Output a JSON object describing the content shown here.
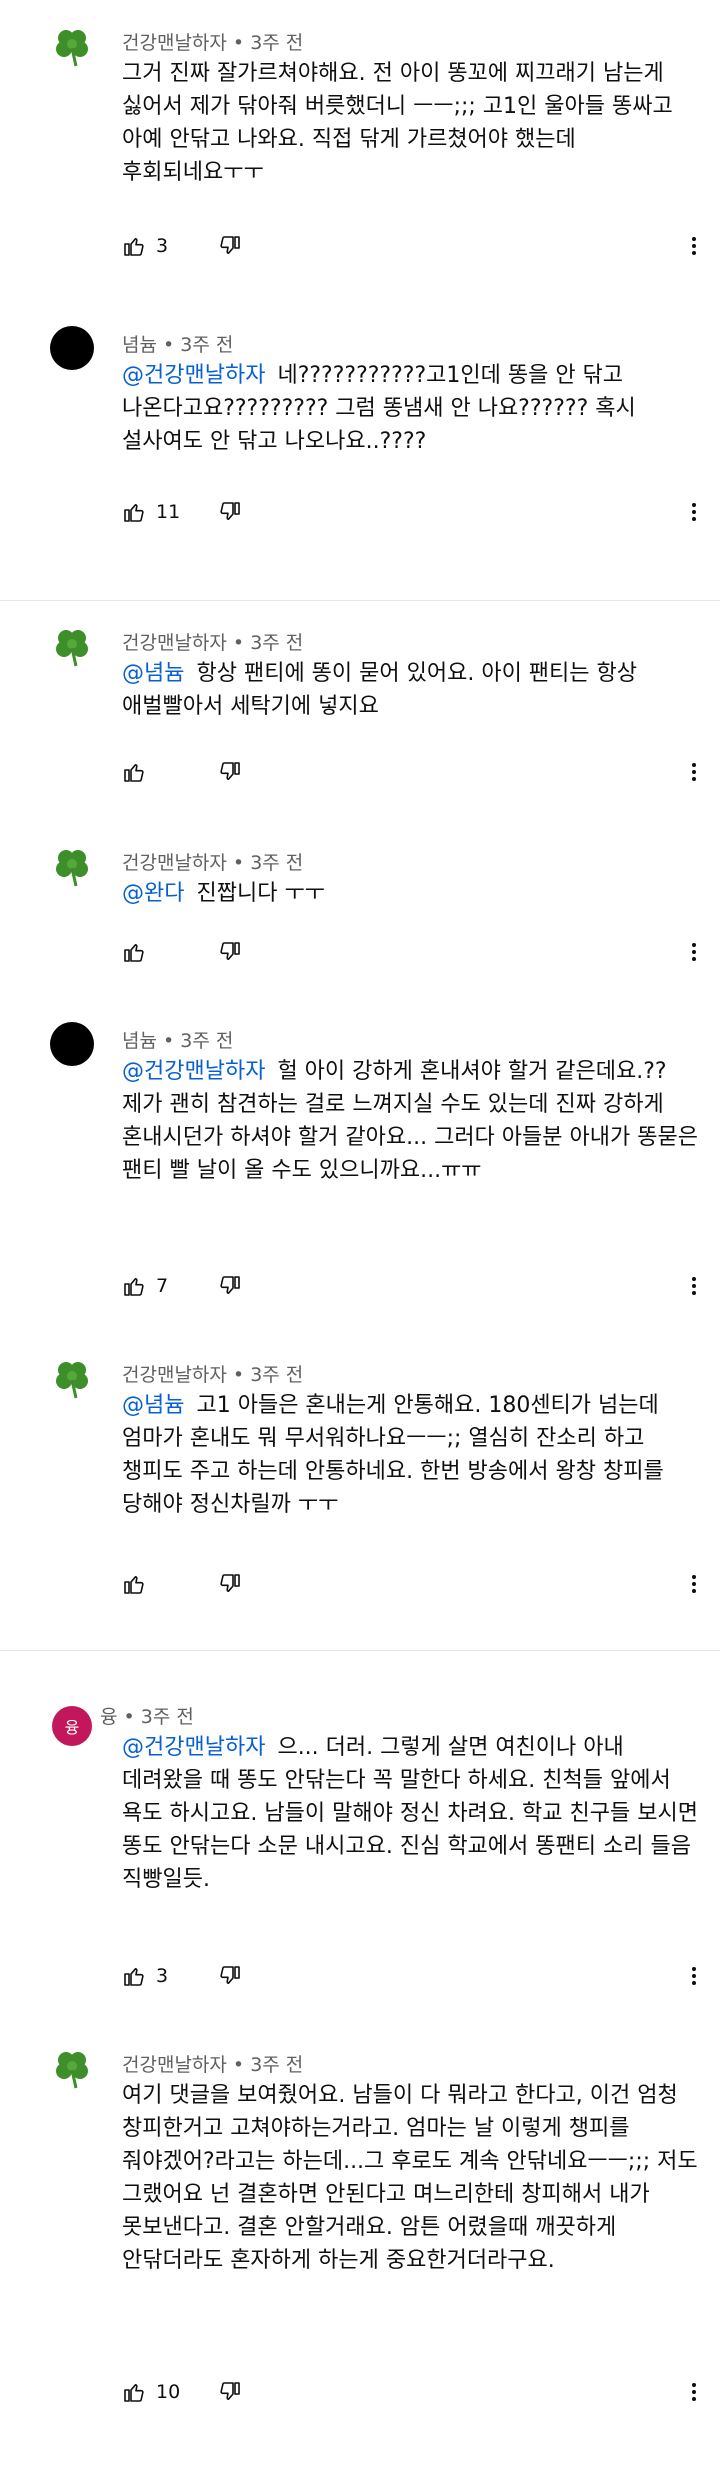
{
  "comments": [
    {
      "author": "건강맨날하자",
      "time": "3주 전",
      "avatar": "clover",
      "mention": "",
      "text": "그거 진짜 잘가르쳐야해요. 전 아이 똥꼬에 찌끄래기 남는게 싫어서 제가 닦아줘 버릇했더니 ㅡㅡ;;; 고1인 울아들 똥싸고 아예 안닦고 나와요. 직접 닦게 가르쳤어야 했는데 후회되네요ㅜㅜ",
      "likes": "3"
    },
    {
      "author": "념늄",
      "time": "3주 전",
      "avatar": "black",
      "mention": "@건강맨날하자",
      "text": "네???????????고1인데 똥을 안 닦고 나온다고요????????? 그럼 똥냄새 안 나요?????? 혹시 설사여도 안 닦고 나오나요..????",
      "likes": "11"
    },
    {
      "author": "건강맨날하자",
      "time": "3주 전",
      "avatar": "clover",
      "mention": "@념늄",
      "text": "항상 팬티에 똥이 묻어 있어요. 아이 팬티는 항상 애벌빨아서 세탁기에 넣지요",
      "likes": ""
    },
    {
      "author": "건강맨날하자",
      "time": "3주 전",
      "avatar": "clover",
      "mention": "@완다",
      "text": "진짭니다 ㅜㅜ",
      "likes": ""
    },
    {
      "author": "념늄",
      "time": "3주 전",
      "avatar": "black",
      "mention": "@건강맨날하자",
      "text": "헐 아이 강하게 혼내셔야 할거 같은데요.?? 제가 괜히 참견하는 걸로 느껴지실 수도 있는데 진짜 강하게 혼내시던가 하셔야 할거 같아요... 그러다 아들분 아내가 똥묻은 팬티 빨 날이 올 수도 있으니까요...ㅠㅠ",
      "likes": "7"
    },
    {
      "author": "건강맨날하자",
      "time": "3주 전",
      "avatar": "clover",
      "mention": "@념늄",
      "text": "고1 아들은 혼내는게 안통해요. 180센티가 넘는데 엄마가 혼내도 뭐 무서워하나요ㅡㅡ;; 열심히 잔소리 하고 챙피도 주고 하는데 안통하네요. 한번 방송에서 왕창 창피를 당해야 정신차릴까 ㅜㅜ",
      "likes": ""
    },
    {
      "author": "융",
      "time": "3주 전",
      "avatar": "letter",
      "avatar_letter": "융",
      "mention": "@건강맨날하자",
      "text": "으... 더러. 그렇게 살면 여친이나 아내 데려왔을 때 똥도 안닦는다 꼭 말한다 하세요. 친척들 앞에서 욕도 하시고요. 남들이 말해야 정신 차려요. 학교 친구들 보시면 똥도 안닦는다 소문 내시고요. 진심 학교에서 똥팬티 소리 들음 직빵일듯.",
      "likes": "3"
    },
    {
      "author": "건강맨날하자",
      "time": "3주 전",
      "avatar": "clover",
      "mention": "",
      "text": "여기 댓글을 보여줬어요. 남들이 다 뭐라고 한다고, 이건 엄청 창피한거고 고쳐야하는거라고. 엄마는 날 이렇게 챙피를 줘야겠어?라고는 하는데...그 후로도 계속 안닦네요ㅡㅡ;;; 저도 그랬어요 넌 결혼하면 안된다고 며느리한테 창피해서 내가 못보낸다고. 결혼 안할거래요. 암튼 어렸을때 깨끗하게 안닦더라도 혼자하게 하는게 중요한거더라구요.",
      "likes": "10"
    }
  ],
  "icons": {
    "like": "thumbs-up-icon",
    "dislike": "thumbs-down-icon",
    "more": "more-vertical-icon",
    "clover_color": "#3e8f2a",
    "mention_color": "#065fd4"
  }
}
